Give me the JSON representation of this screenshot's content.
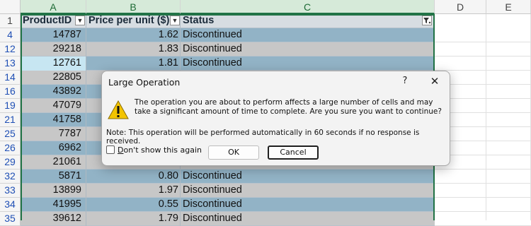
{
  "columns": [
    "A",
    "B",
    "C",
    "D",
    "E"
  ],
  "header_row_number": "1",
  "table_headers": [
    "ProductID",
    "Price per unit ($)",
    "Status"
  ],
  "rows": [
    {
      "row": "4",
      "id": "14787",
      "price": "1.62",
      "status": "Discontinued"
    },
    {
      "row": "12",
      "id": "29218",
      "price": "1.83",
      "status": "Discontinued"
    },
    {
      "row": "13",
      "id": "12761",
      "price": "1.81",
      "status": "Discontinued"
    },
    {
      "row": "14",
      "id": "22805",
      "price": "",
      "status": ""
    },
    {
      "row": "16",
      "id": "43892",
      "price": "",
      "status": ""
    },
    {
      "row": "19",
      "id": "47079",
      "price": "",
      "status": ""
    },
    {
      "row": "21",
      "id": "41758",
      "price": "",
      "status": ""
    },
    {
      "row": "25",
      "id": "7787",
      "price": "",
      "status": ""
    },
    {
      "row": "26",
      "id": "6962",
      "price": "",
      "status": ""
    },
    {
      "row": "29",
      "id": "21061",
      "price": "",
      "status": ""
    },
    {
      "row": "32",
      "id": "5871",
      "price": "0.80",
      "status": "Discontinued"
    },
    {
      "row": "33",
      "id": "13899",
      "price": "1.97",
      "status": "Discontinued"
    },
    {
      "row": "34",
      "id": "41995",
      "price": "0.55",
      "status": "Discontinued"
    },
    {
      "row": "35",
      "id": "39612",
      "price": "1.79",
      "status": "Discontinued"
    }
  ],
  "dialog": {
    "title": "Large Operation",
    "help": "?",
    "close": "✕",
    "message": "The operation you are about to perform affects a large number of cells and may take a significant amount of time to complete. Are you sure you want to continue?",
    "note": "Note: This operation will be performed automatically in 60 seconds if no response is received.",
    "checkbox_label_underlined": "D",
    "checkbox_label_rest": "on't show this again",
    "ok_label": "OK",
    "cancel_label": "Cancel"
  },
  "colors": {
    "row_blue": "#92b3c6",
    "row_gray": "#c7c7c7",
    "selection": "#217346"
  }
}
